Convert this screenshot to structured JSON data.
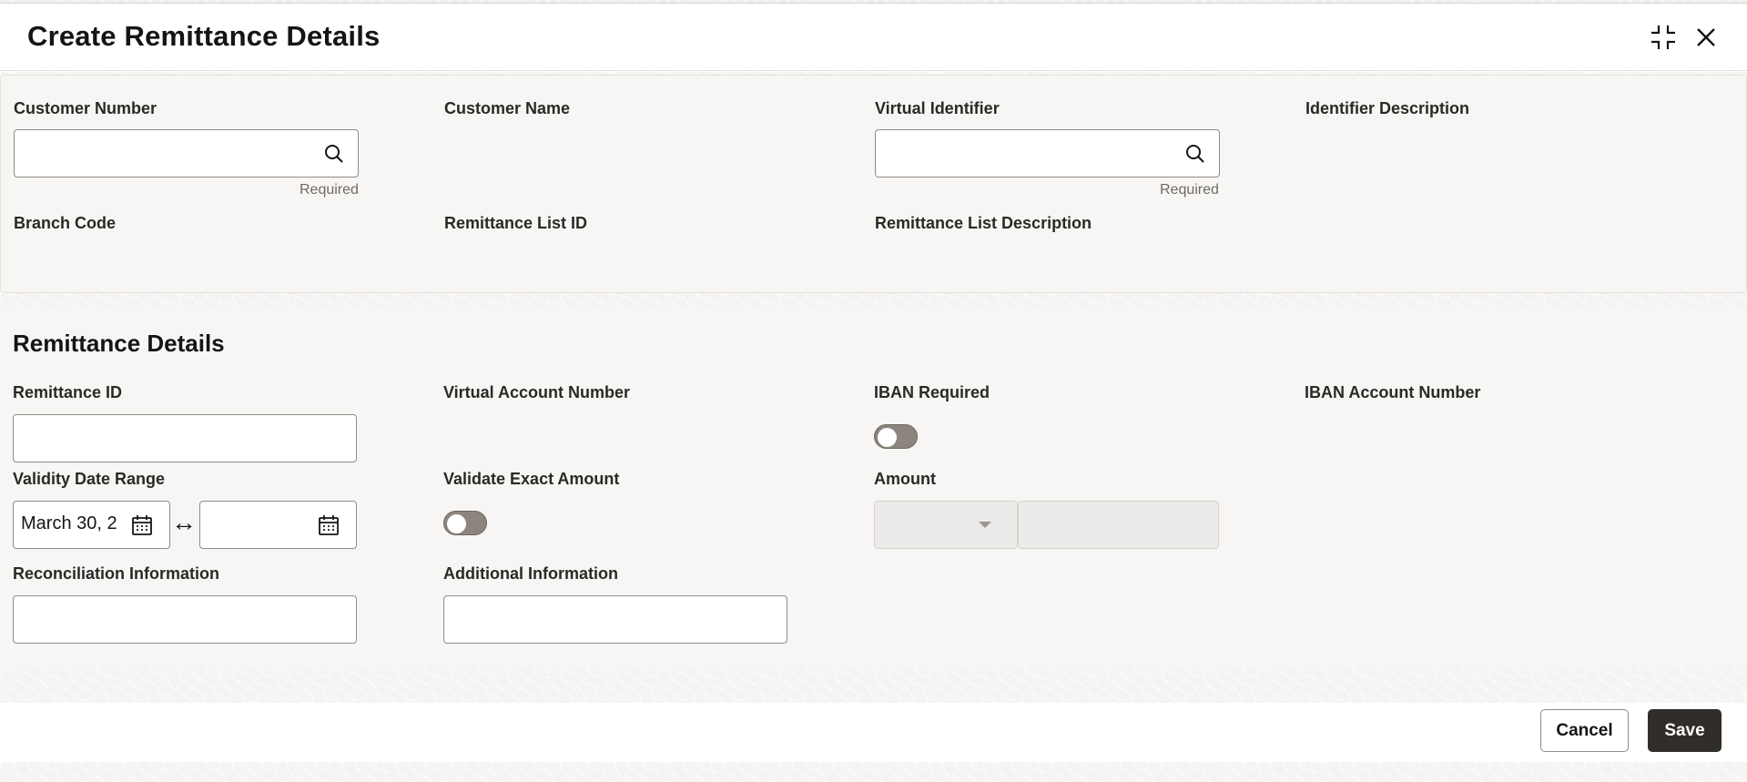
{
  "dialog": {
    "title": "Create Remittance Details",
    "icons": {
      "collapse": "collapse-icon",
      "close": "close-icon"
    }
  },
  "customer_panel": {
    "customer_number": {
      "label": "Customer Number",
      "value": "",
      "hint": "Required"
    },
    "customer_name": {
      "label": "Customer Name",
      "value": ""
    },
    "virtual_identifier": {
      "label": "Virtual Identifier",
      "value": "",
      "hint": "Required"
    },
    "identifier_description": {
      "label": "Identifier Description",
      "value": ""
    },
    "branch_code": {
      "label": "Branch Code",
      "value": ""
    },
    "remittance_list_id": {
      "label": "Remittance List ID",
      "value": ""
    },
    "remittance_list_description": {
      "label": "Remittance List Description",
      "value": ""
    }
  },
  "remittance_details": {
    "title": "Remittance Details",
    "remittance_id": {
      "label": "Remittance ID",
      "value": ""
    },
    "virtual_account_number": {
      "label": "Virtual Account Number",
      "value": ""
    },
    "iban_required": {
      "label": "IBAN Required",
      "checked": false
    },
    "iban_account_number": {
      "label": "IBAN Account Number",
      "value": ""
    },
    "validity_date_range": {
      "label": "Validity Date Range",
      "start": "March 30, 2",
      "end": ""
    },
    "validate_exact_amount": {
      "label": "Validate Exact Amount",
      "checked": false
    },
    "amount": {
      "label": "Amount",
      "currency": "",
      "value": ""
    },
    "reconciliation_information": {
      "label": "Reconciliation Information",
      "value": ""
    },
    "additional_information": {
      "label": "Additional Information",
      "value": ""
    }
  },
  "footer": {
    "cancel_label": "Cancel",
    "save_label": "Save"
  },
  "colors": {
    "primary_button": "#312d2a",
    "toggle_off": "#8b857e",
    "panel_bg": "#f7f6f4"
  }
}
